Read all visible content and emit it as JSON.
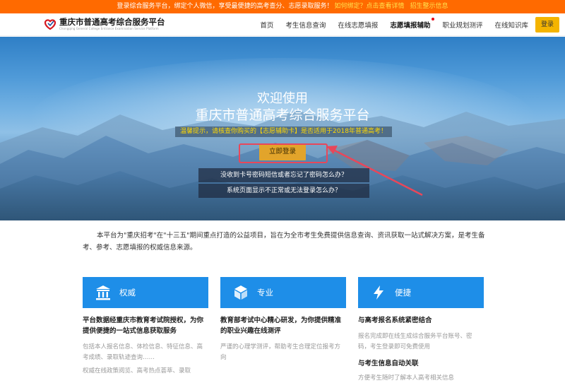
{
  "topbar": {
    "text": "登录综合服务平台，绑定个人微信，享受最便捷的高考查分、志愿录取服务！",
    "link": "如何绑定？点击查看详情",
    "link2": "招生整示信息"
  },
  "logo": {
    "cn": "重庆市普通高考综合服务平台",
    "en": "Chongqing General College Entrance Examination Service Platform"
  },
  "nav": {
    "items": [
      {
        "label": "首页"
      },
      {
        "label": "考生信息查询"
      },
      {
        "label": "在线志愿填报"
      },
      {
        "label": "志愿填报辅助"
      },
      {
        "label": "职业规划测评"
      },
      {
        "label": "在线知识库"
      }
    ],
    "login": "登录"
  },
  "hero": {
    "welcome": "欢迎使用",
    "platform": "重庆市普通高考综合服务平台",
    "notice": "温馨提示，请核查你购买的【志愿辅助卡】是否适用于2018年普通高考！",
    "login_button": "立即登录",
    "help1": "没收到卡号密码短信或者忘记了密码怎么办？",
    "help2": "系统页面显示不正常或无法登录怎么办？"
  },
  "intro": "本平台为\"重庆招考\"在\"十三五\"期间重点打造的公益项目，旨在为全市考生免费提供信息查询、资讯获取一站式解决方案，是考生备考、参考、志愿填报的权威信息来源。",
  "cards": [
    {
      "title": "权威",
      "icon": "building-icon",
      "heading": "平台数据经重庆市教育考试院授权，为你提供便捷的一站式信息获取服务",
      "text": "包括本人报名信息、体检信息、特征信息、高考成绩、录取轨迹查询……",
      "text2": "权威在线政策阅览、高考热点荟萃、录取"
    },
    {
      "title": "专业",
      "icon": "cube-icon",
      "heading": "教育部考试中心精心研发，为你提供精准的职业兴趣在线测评",
      "text": "严谨的心理学测评，帮助考生合理定位报考方向",
      "text2": ""
    },
    {
      "title": "便捷",
      "icon": "lightning-icon",
      "heading": "与高考报名系统紧密结合",
      "text": "报名完成即在线生成综合服务平台账号、密码，考生登录即可免费使用",
      "heading2": "与考生信息自动关联",
      "text2": "方便考生随时了解本人高考相关信息"
    }
  ]
}
